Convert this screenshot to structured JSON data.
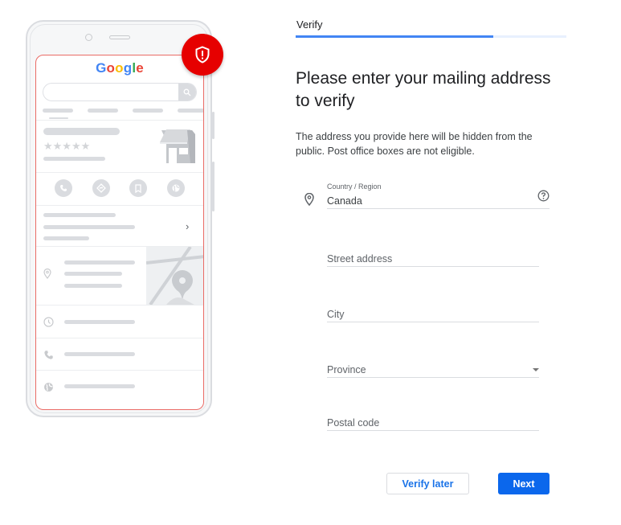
{
  "illustration": {
    "logo_letters": [
      "G",
      "o",
      "o",
      "g",
      "l",
      "e"
    ],
    "stars": "★★★★★",
    "chevron": "›",
    "badge_icon": "shield-alert-icon",
    "action_icons": [
      "phone-icon",
      "directions-icon",
      "bookmark-icon",
      "globe-icon"
    ],
    "row_icons": [
      "location-pin-icon",
      "clock-icon",
      "phone-icon",
      "globe-icon"
    ]
  },
  "step": {
    "title": "Verify",
    "progress_fraction": 0.73
  },
  "heading": "Please enter your mailing address to verify",
  "description": "The address you provide here will be hidden from the public. Post office boxes are not eligible.",
  "form": {
    "country": {
      "label": "Country / Region",
      "value": "Canada",
      "icon": "location-pin-icon",
      "help_icon": "help-circle-icon"
    },
    "street": {
      "placeholder": "Street address",
      "value": ""
    },
    "city": {
      "placeholder": "City",
      "value": ""
    },
    "province": {
      "placeholder": "Province",
      "value": ""
    },
    "postal": {
      "placeholder": "Postal code",
      "value": ""
    }
  },
  "buttons": {
    "verify_later": "Verify later",
    "next": "Next"
  },
  "colors": {
    "accent": "#1a73e8",
    "primary_button": "#0b67ec",
    "progress": "#4285f4",
    "progress_track": "#e8f0fe",
    "badge": "#e60000",
    "screen_outline": "#ea6b66"
  }
}
